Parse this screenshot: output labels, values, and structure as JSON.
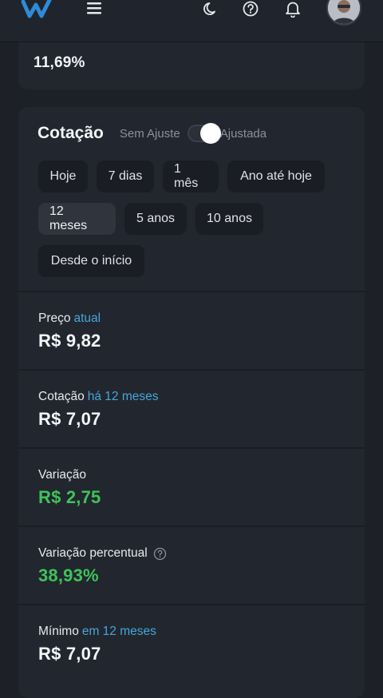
{
  "top_card": {
    "value": "11,69%"
  },
  "cotacao": {
    "title": "Cotação",
    "toggle_left_label": "Sem Ajuste",
    "toggle_right_label": "Ajustada",
    "toggle_state": "Ajustada",
    "periods": [
      "Hoje",
      "7 dias",
      "1 mês",
      "Ano até hoje",
      "12 meses",
      "5 anos",
      "10 anos",
      "Desde o início"
    ],
    "selected_period": "12 meses"
  },
  "stats": [
    {
      "label": "Preço",
      "qualifier": "atual",
      "value": "R$ 9,82"
    },
    {
      "label": "Cotação",
      "qualifier": "há 12 meses",
      "value": "R$ 7,07"
    },
    {
      "label": "Variação",
      "qualifier": "",
      "value": "R$ 2,75"
    },
    {
      "label": "Variação percentual",
      "qualifier": "",
      "value": "38,93%"
    },
    {
      "label": "Mínimo",
      "qualifier": "em 12 meses",
      "value": "R$ 7,07"
    }
  ],
  "colors": {
    "accent_blue": "#46a6d8",
    "positive_green": "#3fc35a",
    "background": "#1d2027",
    "card": "#22262e"
  },
  "icons": {
    "logo": "brand-w-logo",
    "menu": "hamburger-menu-icon",
    "theme": "moon-icon",
    "help": "question-circle-icon",
    "notifications": "bell-icon",
    "profile": "avatar"
  }
}
